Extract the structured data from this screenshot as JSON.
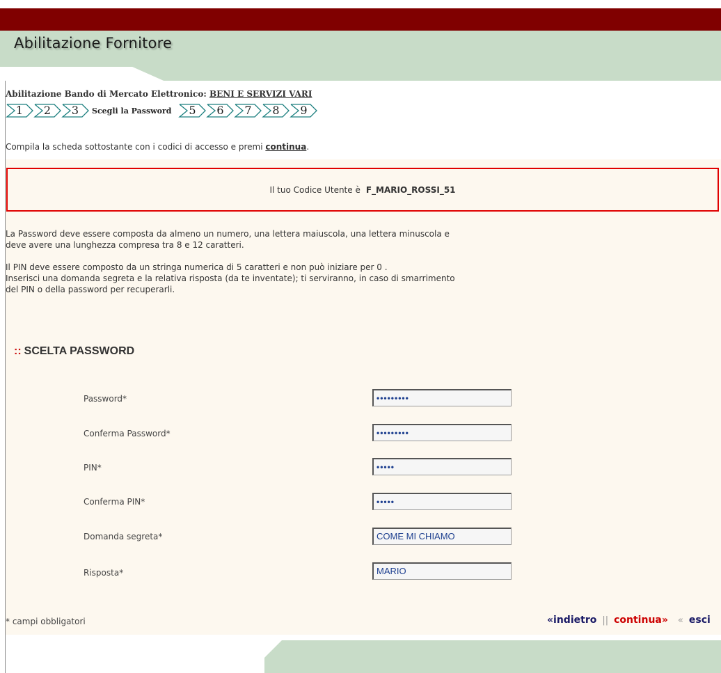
{
  "header": {
    "title": "Abilitazione Fornitore"
  },
  "bando": {
    "prefix": "Abilitazione Bando di Mercato Elettronico:",
    "name": "BENI E SERVIZI VARI"
  },
  "steps": {
    "before": [
      "1",
      "2",
      "3"
    ],
    "current": "Scegli la Password",
    "after": [
      "5",
      "6",
      "7",
      "8",
      "9"
    ]
  },
  "instructions": {
    "text": "Compila la scheda sottostante con i codici di accesso e premi",
    "link": "continua",
    "end": "."
  },
  "user_code": {
    "label": "Il tuo Codice Utente è",
    "value": "F_MARIO_ROSSI_51"
  },
  "info": {
    "password_rule_1": "La Password deve essere composta da almeno un numero, una lettera maiuscola, una lettera minuscola e",
    "password_rule_2": "deve avere una lunghezza compresa tra 8 e 12 caratteri.",
    "pin_rule": "Il PIN deve essere composto da un stringa numerica di 5 caratteri e non può iniziare per 0 .",
    "secret_rule_1": "Inserisci una domanda segreta e la relativa risposta (da te inventate); ti serviranno, in caso di smarrimento",
    "secret_rule_2": "del PIN o della password per recuperarli."
  },
  "section": {
    "colons": "::",
    "title": "SCELTA PASSWORD"
  },
  "form": {
    "password": {
      "label": "Password*",
      "value": "•••••••••"
    },
    "confirm_password": {
      "label": "Conferma Password*",
      "value": "•••••••••"
    },
    "pin": {
      "label": "PIN*",
      "value": "•••••"
    },
    "confirm_pin": {
      "label": "Conferma PIN*",
      "value": "•••••"
    },
    "secret_question": {
      "label": "Domanda segreta*",
      "value": "COME MI CHIAMO"
    },
    "answer": {
      "label": "Risposta*",
      "value": "MARIO"
    }
  },
  "footer": {
    "required_note": "* campi obbligatori"
  },
  "nav": {
    "back": "«indietro",
    "sep": "||",
    "next": "continua»",
    "sep2": "«",
    "exit": "esci"
  },
  "colors": {
    "topbar": "#800000",
    "header_green": "#c8dcc8",
    "error_border": "#e00000",
    "content_bg": "#fdf8ef",
    "input_text": "#1d3f8f"
  }
}
